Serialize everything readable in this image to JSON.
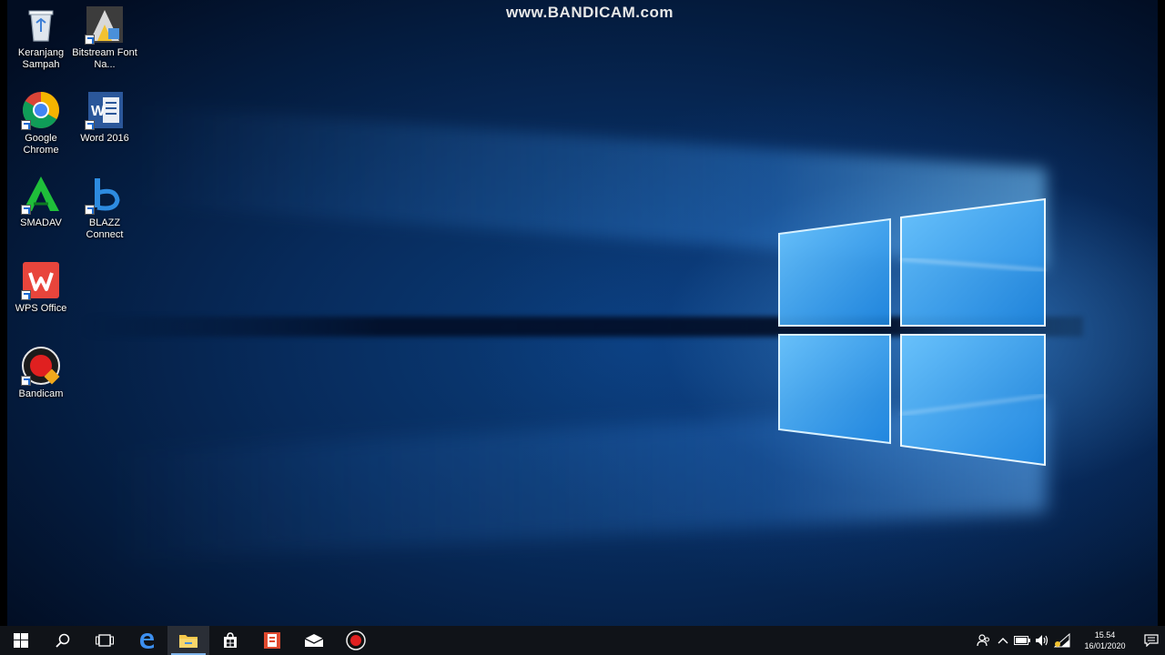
{
  "watermark": "www.BANDICAM.com",
  "desktop_icons": [
    {
      "label": "Keranjang Sampah",
      "icon": "recycle-bin-icon"
    },
    {
      "label": "Bitstream Font Na...",
      "icon": "bitstream-font-icon"
    },
    {
      "label": "Google Chrome",
      "icon": "chrome-icon"
    },
    {
      "label": "Word 2016",
      "icon": "word-icon"
    },
    {
      "label": "SMADAV",
      "icon": "smadav-icon"
    },
    {
      "label": "BLAZZ Connect",
      "icon": "blazz-connect-icon"
    },
    {
      "label": "WPS Office",
      "icon": "wps-office-icon"
    },
    {
      "label": "Bandicam",
      "icon": "bandicam-icon"
    }
  ],
  "taskbar": {
    "pinned": [
      {
        "name": "start-button",
        "icon": "windows-start-icon"
      },
      {
        "name": "search-button",
        "icon": "search-icon"
      },
      {
        "name": "task-view-button",
        "icon": "task-view-icon"
      },
      {
        "name": "edge-button",
        "icon": "edge-icon"
      },
      {
        "name": "file-explorer-button",
        "icon": "folder-icon",
        "active": true
      },
      {
        "name": "store-button",
        "icon": "store-icon"
      },
      {
        "name": "office-button",
        "icon": "office-icon"
      },
      {
        "name": "mail-button",
        "icon": "mail-icon"
      },
      {
        "name": "bandicam-taskbar-button",
        "icon": "record-icon"
      }
    ],
    "tray": {
      "icons": [
        "people-icon",
        "chevron-up-icon",
        "battery-icon",
        "volume-icon",
        "network-icon"
      ],
      "time": "15.54",
      "date": "16/01/2020",
      "notification_icon": "notification-icon"
    }
  },
  "colors": {
    "taskbar_bg": "#101318",
    "accent": "#7fb4ea",
    "wallpaper_glow": "#50aaff"
  }
}
